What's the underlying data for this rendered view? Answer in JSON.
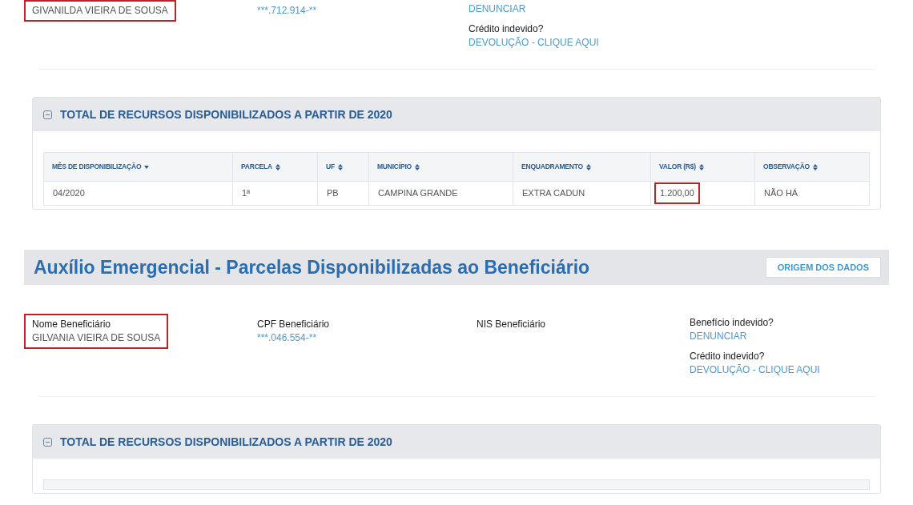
{
  "sections": [
    {
      "fields": [
        {
          "value": "GIVANILDA VIEIRA DE SOUSA",
          "kind": "text",
          "highlighted": true
        },
        {
          "value": "***.712.914-**",
          "kind": "link",
          "highlighted": false
        }
      ],
      "actions": [
        {
          "link": "DENUNCIAR"
        },
        {
          "label": "Crédito indevido?",
          "link": "DEVOLUÇÃO - CLIQUE AQUI"
        }
      ],
      "panel": {
        "title": "TOTAL DE RECURSOS DISPONIBILIZADOS A PARTIR DE 2020",
        "expanded": true,
        "columns": [
          {
            "label": "MÊS DE DISPONIBILIZAÇÃO",
            "sorted": true
          },
          {
            "label": "PARCELA",
            "sorted": false
          },
          {
            "label": "UF",
            "sorted": false
          },
          {
            "label": "MUNICÍPIO",
            "sorted": false
          },
          {
            "label": "ENQUADRAMENTO",
            "sorted": false
          },
          {
            "label": "VALOR (R$)",
            "sorted": false
          },
          {
            "label": "OBSERVAÇÃO",
            "sorted": false
          }
        ],
        "rows": [
          [
            {
              "text": "04/2020",
              "highlighted": false
            },
            {
              "text": "1ª",
              "highlighted": false
            },
            {
              "text": "PB",
              "highlighted": false
            },
            {
              "text": "CAMPINA GRANDE",
              "highlighted": false
            },
            {
              "text": "EXTRA CADUN",
              "highlighted": false
            },
            {
              "text": "1.200,00",
              "highlighted": true
            },
            {
              "text": "NÃO HÁ",
              "highlighted": false
            }
          ]
        ]
      }
    },
    {
      "title": "Auxílio Emergencial - Parcelas Disponibilizadas ao Beneficiário",
      "source_button": "ORIGEM DOS DADOS",
      "fields": [
        {
          "label": "Nome Beneficiário",
          "value": "GILVANIA VIEIRA DE SOUSA",
          "kind": "text",
          "highlighted": true
        },
        {
          "label": "CPF Beneficiário",
          "value": "***.046.554-**",
          "kind": "link",
          "highlighted": false
        },
        {
          "label": "NIS Beneficiário",
          "highlighted": false
        }
      ],
      "actions": [
        {
          "label": "Benefício indevido?",
          "link": "DENUNCIAR"
        },
        {
          "label": "Crédito indevido?",
          "link": "DEVOLUÇÃO - CLIQUE AQUI"
        }
      ],
      "panel": {
        "title": "TOTAL DE RECURSOS DISPONIBILIZADOS A PARTIR DE 2020",
        "expanded": true
      }
    }
  ]
}
